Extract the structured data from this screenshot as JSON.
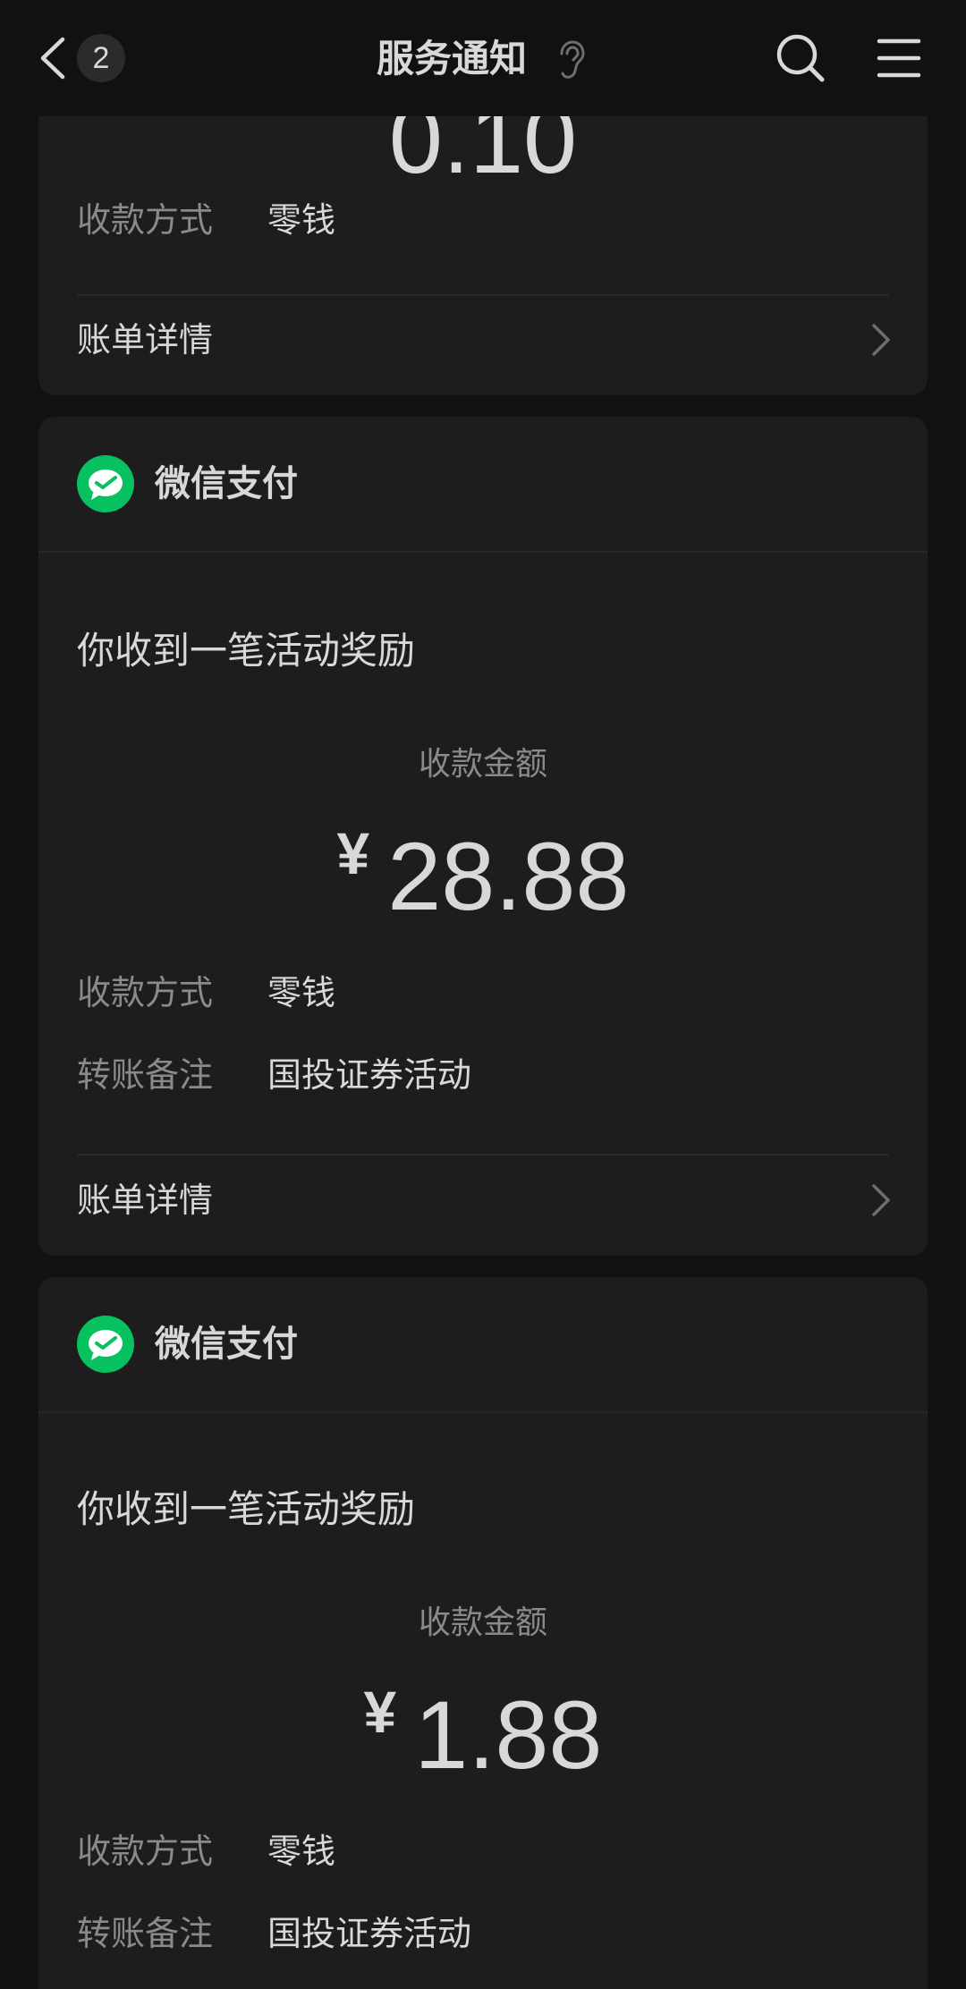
{
  "header": {
    "unread_count": "2",
    "title": "服务通知"
  },
  "card0": {
    "amount_partial": "0.10",
    "payment_method_label": "收款方式",
    "payment_method_value": "零钱",
    "bill_detail_label": "账单详情"
  },
  "cards": [
    {
      "sender": "微信支付",
      "notice_title": "你收到一笔活动奖励",
      "amount_label": "收款金额",
      "currency": "¥",
      "amount": "28.88",
      "payment_method_label": "收款方式",
      "payment_method_value": "零钱",
      "remark_label": "转账备注",
      "remark_value": "国投证券活动",
      "bill_detail_label": "账单详情"
    },
    {
      "sender": "微信支付",
      "notice_title": "你收到一笔活动奖励",
      "amount_label": "收款金额",
      "currency": "¥",
      "amount": "1.88",
      "payment_method_label": "收款方式",
      "payment_method_value": "零钱",
      "remark_label": "转账备注",
      "remark_value": "国投证券活动"
    }
  ],
  "colors": {
    "background": "#111111",
    "card": "#1d1d1d",
    "text_primary": "#d8d8d8",
    "text_secondary": "#8a8a8a",
    "wechat_green": "#07c160"
  },
  "icons": {
    "back": "chevron-left-icon",
    "ear": "ear-icon",
    "search": "search-icon",
    "menu": "hamburger-menu-icon",
    "wechat_pay": "wechat-pay-icon",
    "chevron": "chevron-right-icon"
  }
}
